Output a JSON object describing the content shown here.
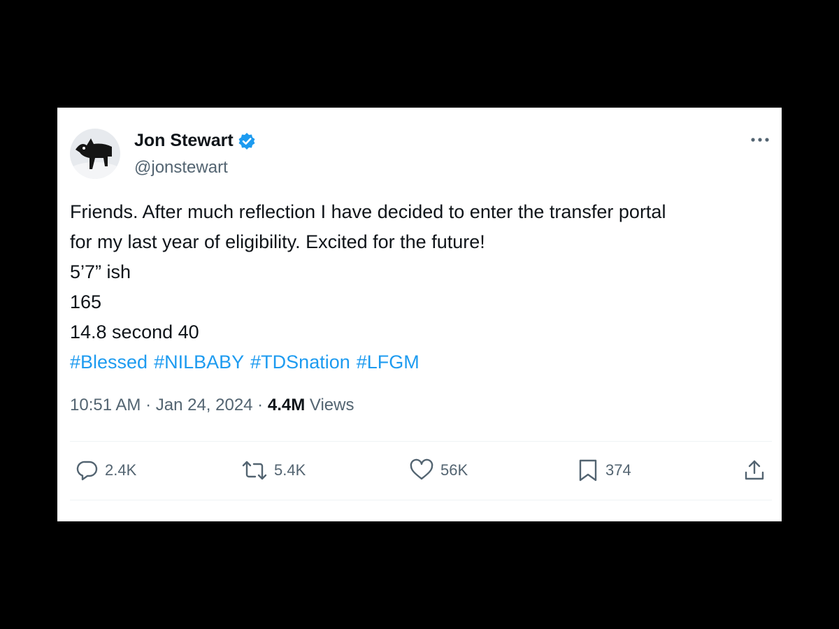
{
  "tweet": {
    "author": {
      "display_name": "Jon Stewart",
      "handle": "@jonstewart",
      "verified": true
    },
    "body_lines": [
      "Friends. After much reflection I have decided to enter the transfer portal",
      "for my last year of eligibility. Excited for the future!",
      "5’7” ish",
      "165",
      "14.8 second 40"
    ],
    "hashtags": [
      "#Blessed",
      "#NILBABY",
      "#TDSnation",
      "#LFGM"
    ],
    "timestamp": "10:51 AM · Jan 24, 2024 · ",
    "views_count": "4.4M",
    "views_label": " Views",
    "actions": {
      "replies": "2.4K",
      "reposts": "5.4K",
      "likes": "56K",
      "bookmarks": "374"
    }
  },
  "icons": {
    "more": "more-horizontal-icon",
    "verified": "verified-badge-icon",
    "reply": "reply-icon",
    "repost": "repost-icon",
    "like": "heart-icon",
    "bookmark": "bookmark-icon",
    "share": "share-icon"
  },
  "colors": {
    "accent": "#1d9bf0",
    "text_primary": "#0f1419",
    "text_secondary": "#536471",
    "background": "#000000",
    "card": "#ffffff"
  }
}
